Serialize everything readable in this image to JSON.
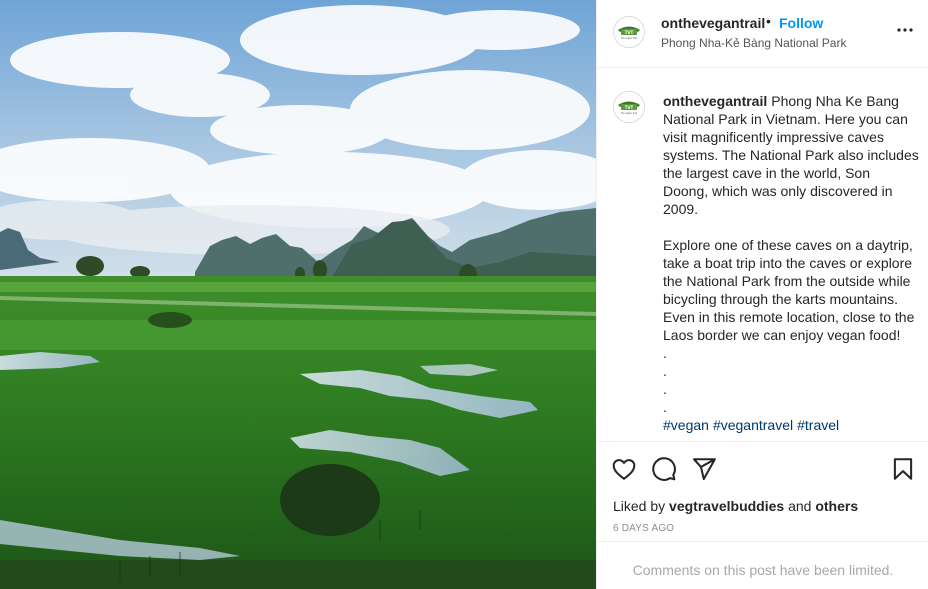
{
  "post": {
    "username": "onthevegantrail",
    "separator": "•",
    "follow_label": "Follow",
    "location": "Phong Nha-Kẻ Bàng National Park",
    "avatar_text": "the vegan trail",
    "more_icon": "more-horizontal-icon",
    "image_alt": "Green rice paddies with pools of water and karst mountains under a cloudy blue sky"
  },
  "caption": {
    "username": "onthevegantrail",
    "lines": [
      "Phong Nha Ke Bang National Park in Vietnam. Here you can visit magnificently impressive caves systems. The National Park also includes the largest cave in the world, Son Doong, which was only discovered in 2009.",
      "Explore one of these caves on a daytrip, take a boat trip into the caves or explore the National Park from the outside while bicycling through the karts mountains. Even in this remote location, close to the Laos border we can enjoy vegan food!",
      ".",
      ".",
      ".",
      "."
    ],
    "hashtags": [
      "#vegan",
      "#vegantravel",
      "#travel"
    ]
  },
  "actions": {
    "like_icon": "heart-icon",
    "comment_icon": "comment-icon",
    "share_icon": "send-icon",
    "save_icon": "bookmark-icon"
  },
  "likes": {
    "prefix": "Liked by",
    "user": "vegtravelbuddies",
    "and": "and",
    "others": "others"
  },
  "timestamp": "6 DAYS AGO",
  "comments_limited": "Comments on this post have been limited.",
  "colors": {
    "link_blue": "#0095f6",
    "hashtag": "#00376b",
    "muted": "#8e8e8e",
    "border": "#efefef"
  }
}
